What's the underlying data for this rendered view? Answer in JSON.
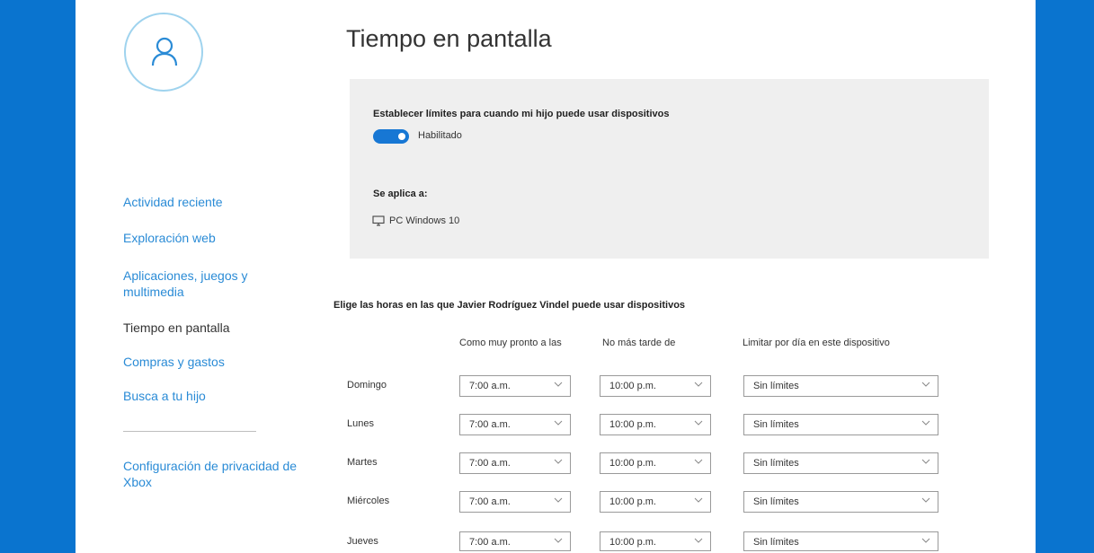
{
  "page": {
    "title": "Tiempo en pantalla"
  },
  "colors": {
    "accent": "#0a74cf",
    "link": "#2a8bd6",
    "panel": "#efefef",
    "toggle_on": "#1777d4"
  },
  "nav": {
    "items": [
      {
        "label": "Actividad reciente"
      },
      {
        "label": "Exploración web"
      },
      {
        "label": "Aplicaciones, juegos y multimedia"
      },
      {
        "label": "Tiempo en pantalla"
      },
      {
        "label": "Compras y gastos"
      },
      {
        "label": "Busca a tu hijo"
      }
    ],
    "xbox": {
      "label": "Configuración de privacidad de Xbox"
    }
  },
  "limits": {
    "label": "Establecer límites para cuando mi hijo puede usar dispositivos",
    "toggle_on": true,
    "toggle_text": "Habilitado",
    "applies_label": "Se aplica a:",
    "device_icon": "monitor-icon",
    "device": "PC Windows 10"
  },
  "schedule": {
    "heading": "Elige las horas en las que Javier Rodríguez Vindel puede usar dispositivos",
    "columns": {
      "earliest": "Como muy pronto a las",
      "latest": "No más tarde de",
      "limit": "Limitar por día en este dispositivo"
    },
    "rows": [
      {
        "day": "Domingo",
        "earliest": "7:00 a.m.",
        "latest": "10:00 p.m.",
        "limit": "Sin límites"
      },
      {
        "day": "Lunes",
        "earliest": "7:00 a.m.",
        "latest": "10:00 p.m.",
        "limit": "Sin límites"
      },
      {
        "day": "Martes",
        "earliest": "7:00 a.m.",
        "latest": "10:00 p.m.",
        "limit": "Sin límites"
      },
      {
        "day": "Miércoles",
        "earliest": "7:00 a.m.",
        "latest": "10:00 p.m.",
        "limit": "Sin límites"
      },
      {
        "day": "Jueves",
        "earliest": "7:00 a.m.",
        "latest": "10:00 p.m.",
        "limit": "Sin límites"
      }
    ]
  }
}
